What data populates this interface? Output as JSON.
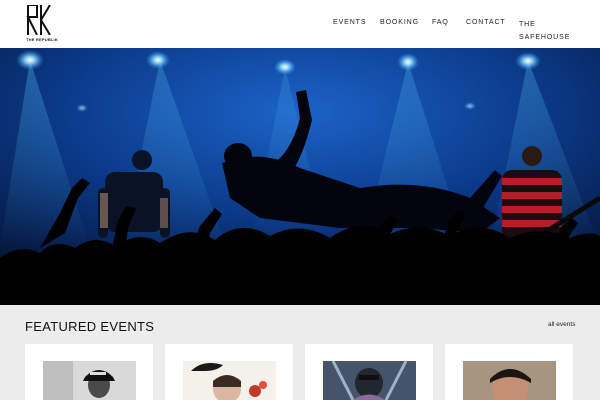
{
  "brand": {
    "logo_text": "THE REPUBLIK"
  },
  "nav": {
    "items": [
      "EVENTS",
      "BOOKING",
      "FAQ",
      "CONTACT",
      "THE SAFEHOUSE"
    ]
  },
  "featured": {
    "title": "FEATURED EVENTS",
    "all_link": "all events"
  },
  "colors": {
    "hero_blue": "#0b3a8a",
    "stage_light": "#7fd8ff",
    "band_bg": "#ececec"
  }
}
